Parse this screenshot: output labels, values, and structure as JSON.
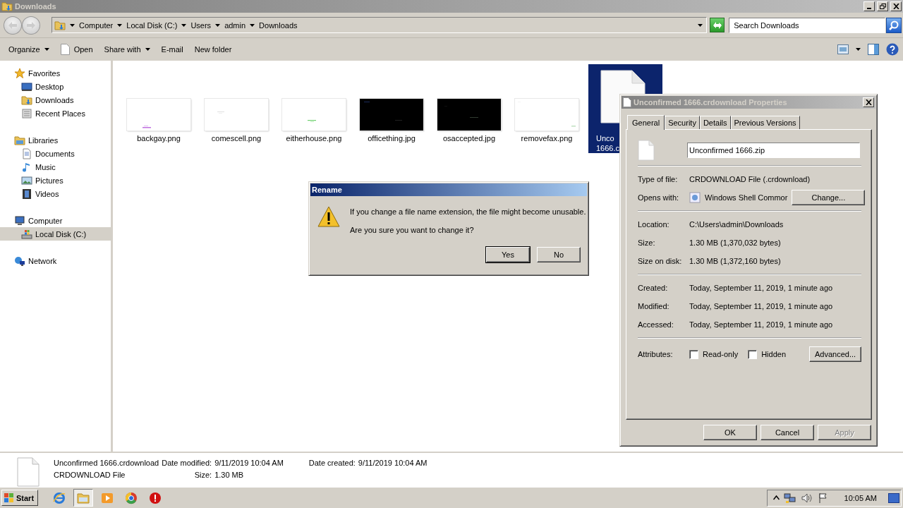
{
  "window": {
    "title": "Downloads",
    "active": false
  },
  "address_bar": {
    "breadcrumbs": [
      "Computer",
      "Local Disk (C:)",
      "Users",
      "admin",
      "Downloads"
    ]
  },
  "search": {
    "placeholder": "Search Downloads"
  },
  "toolbar": {
    "items": [
      {
        "label": "Organize",
        "kind": "menu"
      },
      {
        "label": "Open",
        "kind": "file"
      },
      {
        "label": "Share with",
        "kind": "menu"
      },
      {
        "label": "E-mail",
        "kind": "plain"
      },
      {
        "label": "New folder",
        "kind": "plain"
      }
    ]
  },
  "sidebar": {
    "groups": [
      {
        "label": "Favorites",
        "kind": "star",
        "selected": false,
        "children": [
          {
            "label": "Desktop",
            "kind": "desktop",
            "selected": false
          },
          {
            "label": "Downloads",
            "kind": "downloads",
            "selected": false
          },
          {
            "label": "Recent Places",
            "kind": "recent",
            "selected": false
          }
        ]
      },
      {
        "label": "Libraries",
        "kind": "libraries",
        "selected": false,
        "children": [
          {
            "label": "Documents",
            "kind": "documents",
            "selected": false
          },
          {
            "label": "Music",
            "kind": "music",
            "selected": false
          },
          {
            "label": "Pictures",
            "kind": "pictures",
            "selected": false
          },
          {
            "label": "Videos",
            "kind": "videos",
            "selected": false
          }
        ]
      },
      {
        "label": "Computer",
        "kind": "computer",
        "selected": false,
        "children": [
          {
            "label": "Local Disk (C:)",
            "kind": "disk",
            "selected": true
          }
        ]
      },
      {
        "label": "Network",
        "kind": "network",
        "selected": false
      }
    ]
  },
  "files": [
    {
      "name": "backgay.png",
      "kind": "picture",
      "selected": false
    },
    {
      "name": "comescell.png",
      "kind": "picture",
      "selected": false
    },
    {
      "name": "eitherhouse.png",
      "kind": "picture",
      "selected": false
    },
    {
      "name": "officething.jpg",
      "kind": "picture",
      "selected": false
    },
    {
      "name": "osaccepted.jpg",
      "kind": "picture",
      "selected": false
    },
    {
      "name": "removefax.png",
      "kind": "picture",
      "selected": false
    },
    {
      "name": "Unco\n1666.c",
      "kind": "document",
      "selected": true
    }
  ],
  "details": {
    "name": "Unconfirmed 1666.crdownload",
    "type": "CRDOWNLOAD File",
    "date_modified": {
      "label": "Date modified:",
      "value": "9/11/2019 10:04 AM"
    },
    "date_created": {
      "label": "Date created:",
      "value": "9/11/2019 10:04 AM"
    },
    "size": {
      "label": "Size:",
      "value": "1.30 MB"
    }
  },
  "rename_dialog": {
    "title": "Rename",
    "active": true,
    "message": "If you change a file name extension, the file might become unusable.",
    "question": "Are you sure you want to change it?",
    "buttons": [
      {
        "label": "Yes",
        "default": true
      },
      {
        "label": "No",
        "default": false
      }
    ]
  },
  "properties_dialog": {
    "title": "Unconfirmed 1666.crdownload Properties",
    "active": false,
    "tabs": [
      {
        "label": "General",
        "selected": true
      },
      {
        "label": "Security",
        "selected": false
      },
      {
        "label": "Details",
        "selected": false
      },
      {
        "label": "Previous Versions",
        "selected": false
      }
    ],
    "filename": "Unconfirmed 1666.zip",
    "sections": [
      [
        {
          "label": "Type of file:",
          "value": "CRDOWNLOAD File (.crdownload)",
          "kind": "text"
        },
        {
          "label": "Opens with:",
          "value": "Windows Shell Commor",
          "kind": "app",
          "button": "Change..."
        }
      ],
      [
        {
          "label": "Location:",
          "value": "C:\\Users\\admin\\Downloads",
          "kind": "text"
        },
        {
          "label": "Size:",
          "value": "1.30 MB (1,370,032 bytes)",
          "kind": "text"
        },
        {
          "label": "Size on disk:",
          "value": "1.30 MB (1,372,160 bytes)",
          "kind": "text"
        }
      ],
      [
        {
          "label": "Created:",
          "value": "Today, September 11, 2019, 1 minute ago",
          "kind": "text"
        },
        {
          "label": "Modified:",
          "value": "Today, September 11, 2019, 1 minute ago",
          "kind": "text"
        },
        {
          "label": "Accessed:",
          "value": "Today, September 11, 2019, 1 minute ago",
          "kind": "text"
        }
      ]
    ],
    "attributes": {
      "label": "Attributes:",
      "checkboxes": [
        {
          "label": "Read-only",
          "checked": false
        },
        {
          "label": "Hidden",
          "checked": false
        }
      ],
      "button": "Advanced..."
    },
    "buttons": [
      {
        "label": "OK",
        "disabled": false
      },
      {
        "label": "Cancel",
        "disabled": false
      },
      {
        "label": "Apply",
        "disabled": true
      }
    ]
  },
  "taskbar": {
    "start": "Start",
    "apps": [
      {
        "kind": "browser-e",
        "selected": false
      },
      {
        "kind": "folder",
        "selected": true
      },
      {
        "kind": "media",
        "selected": false
      },
      {
        "kind": "browser",
        "selected": false
      },
      {
        "kind": "alert",
        "selected": false
      }
    ],
    "clock": "10:05 AM"
  }
}
